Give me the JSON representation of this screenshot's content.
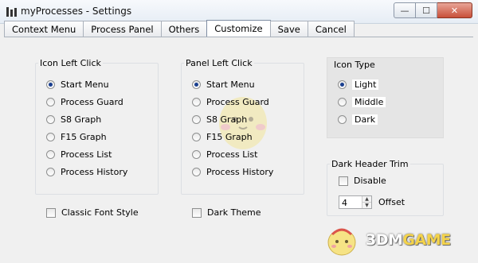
{
  "window": {
    "title": "myProcesses - Settings",
    "close_glyph": "✕",
    "minimize_glyph": "—",
    "maximize_glyph": "☐"
  },
  "tabs": [
    {
      "label": "Context Menu"
    },
    {
      "label": "Process Panel"
    },
    {
      "label": "Others"
    },
    {
      "label": "Customize",
      "active": true
    },
    {
      "label": "Save"
    },
    {
      "label": "Cancel"
    }
  ],
  "icon_left_click": {
    "title": "Icon Left Click",
    "options": [
      "Start Menu",
      "Process Guard",
      "S8 Graph",
      "F15 Graph",
      "Process List",
      "Process History"
    ],
    "selected": "Start Menu"
  },
  "panel_left_click": {
    "title": "Panel Left Click",
    "options": [
      "Start Menu",
      "Process Guard",
      "S8 Graph",
      "F15 Graph",
      "Process List",
      "Process History"
    ],
    "selected": "Start Menu"
  },
  "icon_type": {
    "title": "Icon Type",
    "options": [
      "Light",
      "Middle",
      "Dark"
    ],
    "selected": "Light"
  },
  "dark_header_trim": {
    "title": "Dark Header Trim",
    "disable_label": "Disable",
    "disable_checked": false,
    "offset_value": "4",
    "offset_label": "Offset"
  },
  "classic_font_style": {
    "label": "Classic Font Style",
    "checked": false
  },
  "dark_theme": {
    "label": "Dark Theme",
    "checked": false
  },
  "watermark": {
    "text_a": "3DM",
    "text_b": "GAME"
  }
}
